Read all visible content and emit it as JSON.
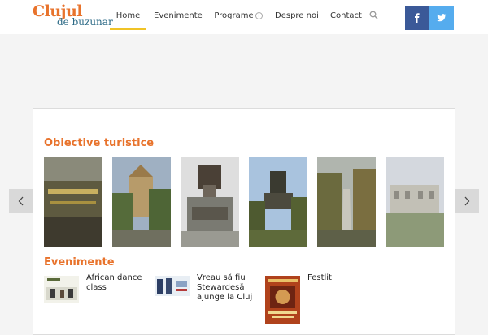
{
  "logo": {
    "main": "Clujul",
    "sub": "de buzunar"
  },
  "nav": {
    "items": [
      {
        "label": "Home"
      },
      {
        "label": "Evenimente"
      },
      {
        "label": "Programe"
      },
      {
        "label": "Despre noi"
      },
      {
        "label": "Contact"
      }
    ],
    "info_icon": "i"
  },
  "social": {
    "facebook": "f"
  },
  "sections": {
    "attractions_title": "Obiective turistice",
    "events_title": "Evenimente"
  },
  "events": [
    {
      "title": "African dance class"
    },
    {
      "title": "Vreau să fiu Stewardesă ajunge la Cluj"
    },
    {
      "title": "Festlit"
    }
  ],
  "colors": {
    "accent": "#e8732c",
    "brand_blue": "#2c6a86",
    "active_underline": "#f0c326",
    "facebook": "#3b5998",
    "twitter": "#55acee"
  }
}
